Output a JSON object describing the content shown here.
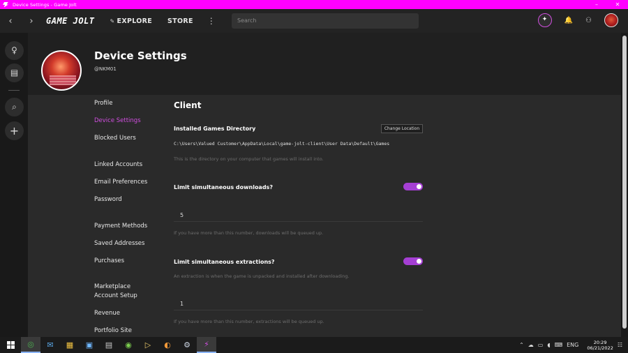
{
  "window": {
    "title": "Device Settings - Game Jolt",
    "controls": [
      "–",
      "✕"
    ]
  },
  "topnav": {
    "back": "‹",
    "forward": "›",
    "logo": "GAME JOLT",
    "explore": "EXPLORE",
    "store": "STORE",
    "more": "⋮",
    "search_placeholder": "Search",
    "quest_glyph": "✦",
    "bell_glyph": "🔔",
    "friends_glyph": "⚇"
  },
  "leftrail": {
    "items": [
      "♀",
      "▤",
      "⌕",
      "+"
    ]
  },
  "header": {
    "title": "Device Settings",
    "username": "@NKM01"
  },
  "sidenav": {
    "items": [
      {
        "label": "Profile",
        "active": false
      },
      {
        "label": "Device Settings",
        "active": true
      },
      {
        "label": "Blocked Users",
        "active": false
      },
      {
        "label": "Linked Accounts",
        "active": false
      },
      {
        "label": "Email Preferences",
        "active": false
      },
      {
        "label": "Password",
        "active": false
      },
      {
        "label": "Payment Methods",
        "active": false
      },
      {
        "label": "Saved Addresses",
        "active": false
      },
      {
        "label": "Purchases",
        "active": false
      },
      {
        "label": "Marketplace Account Setup",
        "active": false
      },
      {
        "label": "Revenue",
        "active": false
      },
      {
        "label": "Portfolio Site",
        "active": false
      }
    ]
  },
  "client": {
    "heading": "Client",
    "installed_dir": {
      "label": "Installed Games Directory",
      "button": "Change Location",
      "path": "C:\\Users\\Valued Customer\\AppData\\Local\\game-jolt-client\\User Data\\Default\\Games",
      "help": "This is the directory on your computer that games will install into."
    },
    "downloads": {
      "label": "Limit simultaneous downloads?",
      "enabled": true,
      "value": "5",
      "help": "If you have more than this number, downloads will be queued up."
    },
    "extractions": {
      "label": "Limit simultaneous extractions?",
      "enabled": true,
      "description": "An extraction is when the game is unpacked and installed after downloading.",
      "value": "1",
      "help": "If you have more than this number, extractions will be queued up."
    }
  },
  "taskbar": {
    "apps": [
      "◎",
      "✉",
      "▦",
      "▣",
      "▤",
      "◉",
      "▷",
      "◐",
      "⚙",
      "⚡"
    ],
    "tray": {
      "chevron": "⌃",
      "lang": "ENG",
      "time": "20:29",
      "date": "06/21/2022",
      "notify": "☷"
    }
  },
  "colors": {
    "accent": "#d14fe0",
    "toggle": "#a53fd4",
    "titlebar": "#ff00ff"
  }
}
